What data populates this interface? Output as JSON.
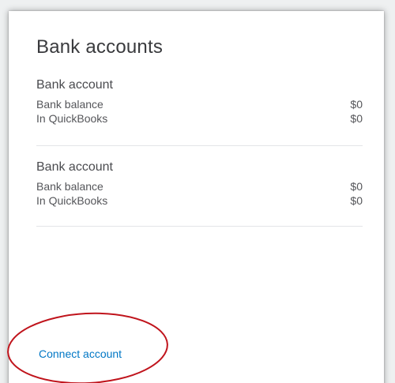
{
  "card": {
    "title": "Bank accounts",
    "accounts": [
      {
        "name": "Bank account",
        "bank_balance_label": "Bank balance",
        "bank_balance_value": "$0",
        "quickbooks_label": "In QuickBooks",
        "quickbooks_value": "$0"
      },
      {
        "name": "Bank account",
        "bank_balance_label": "Bank balance",
        "bank_balance_value": "$0",
        "quickbooks_label": "In QuickBooks",
        "quickbooks_value": "$0"
      }
    ],
    "connect_label": "Connect account"
  },
  "colors": {
    "link": "#0077c5",
    "annotation": "#c0141c"
  }
}
